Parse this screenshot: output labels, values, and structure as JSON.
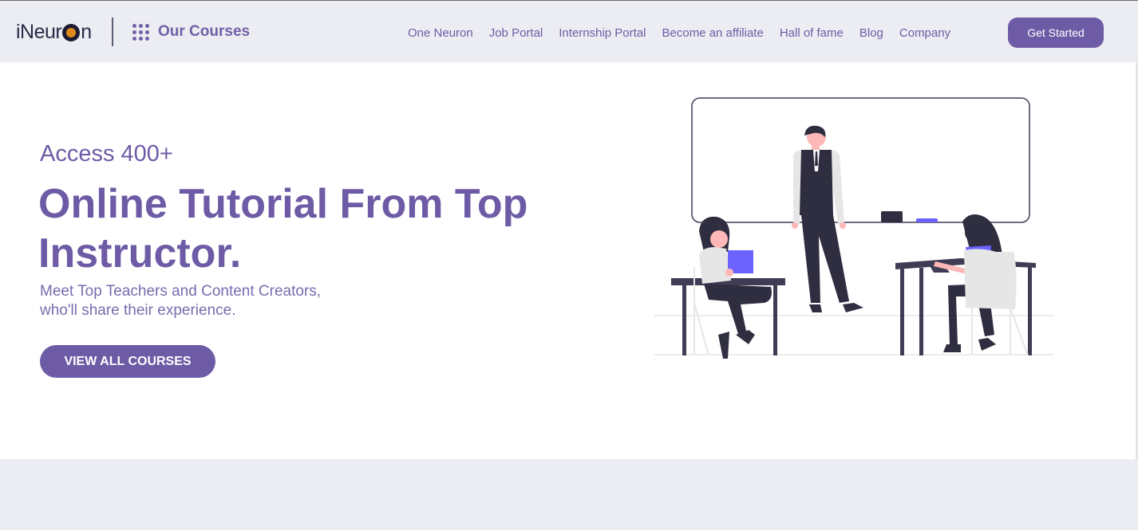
{
  "header": {
    "logo_text_a": "iNeur",
    "logo_text_b": "n",
    "courses_label": "Our Courses",
    "nav": [
      "One Neuron",
      "Job Portal",
      "Internship Portal",
      "Become an affiliate",
      "Hall of fame",
      "Blog",
      "Company"
    ],
    "cta_label": "Get Started"
  },
  "hero": {
    "eyebrow": "Access 400+",
    "headline_line1": "Online Tutorial From Top",
    "headline_line2": "Instructor.",
    "subtext_line1": "Meet Top Teachers and Content Creators,",
    "subtext_line2": "who'll share their experience.",
    "button_label": "VIEW ALL COURSES"
  },
  "colors": {
    "brand": "#6E5BA6",
    "header_bg": "#ECEDF2",
    "accent_purple": "#6C63FF",
    "logo_orange": "#E08A1B"
  },
  "icons": [
    "grid-dots-icon",
    "logo-o-icon",
    "classroom-illustration"
  ]
}
